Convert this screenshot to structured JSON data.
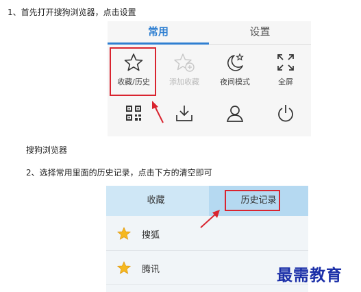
{
  "step1": {
    "text": "1、首先打开搜狗浏览器，点击设置"
  },
  "browser_menu": {
    "tabs": [
      {
        "label": "常用",
        "active": true
      },
      {
        "label": "设置",
        "active": false
      }
    ],
    "items": [
      {
        "label": "收藏/历史",
        "icon": "star-icon",
        "highlighted": true
      },
      {
        "label": "添加收藏",
        "icon": "star-add-icon",
        "disabled": true
      },
      {
        "label": "夜间模式",
        "icon": "moon-star-icon"
      },
      {
        "label": "全屏",
        "icon": "fullscreen-icon"
      },
      {
        "label": "",
        "icon": "qr-code-icon"
      },
      {
        "label": "",
        "icon": "download-icon"
      },
      {
        "label": "",
        "icon": "user-icon"
      },
      {
        "label": "",
        "icon": "power-icon"
      }
    ],
    "accent_color": "#2f7fd1",
    "highlight_color": "#d9242f"
  },
  "caption1": "搜狗浏览器",
  "step2": {
    "text": "2、选择常用里面的历史记录，点击下方的清空即可"
  },
  "history_panel": {
    "tabs": [
      {
        "label": "收藏",
        "active": false
      },
      {
        "label": "历史记录",
        "active": true
      }
    ],
    "rows": [
      {
        "label": "搜狐",
        "icon": "star-icon"
      },
      {
        "label": "腾讯",
        "icon": "star-icon"
      }
    ],
    "star_color": "#f5b820"
  },
  "watermark": "最需教育"
}
